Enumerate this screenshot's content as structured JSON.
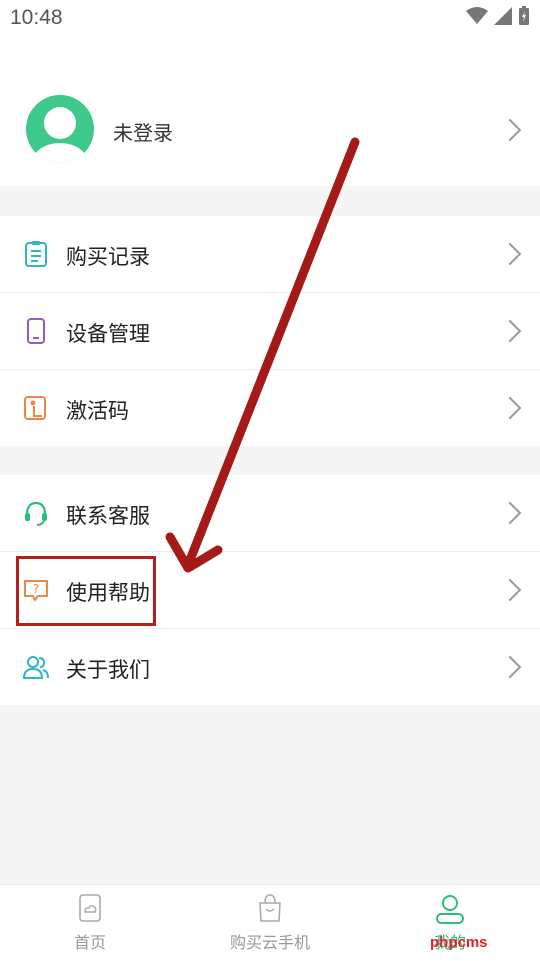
{
  "status_bar": {
    "time": "10:48"
  },
  "profile": {
    "name": "未登录"
  },
  "menu_group_1": [
    {
      "label": "购买记录",
      "icon": "clipboard-icon"
    },
    {
      "label": "设备管理",
      "icon": "phone-device-icon"
    },
    {
      "label": "激活码",
      "icon": "activation-code-icon"
    }
  ],
  "menu_group_2": [
    {
      "label": "联系客服",
      "icon": "headset-icon"
    },
    {
      "label": "使用帮助",
      "icon": "help-chat-icon"
    },
    {
      "label": "关于我们",
      "icon": "users-icon"
    }
  ],
  "tabbar": {
    "tabs": [
      {
        "label": "首页",
        "icon": "home-cloud-icon"
      },
      {
        "label": "购买云手机",
        "icon": "shopping-bag-icon"
      },
      {
        "label": "我的",
        "icon": "profile-icon"
      }
    ],
    "active_index": 2
  },
  "watermark": "phpcms",
  "colors": {
    "accent": "#2dbf7a",
    "annotation": "#b3201c"
  }
}
